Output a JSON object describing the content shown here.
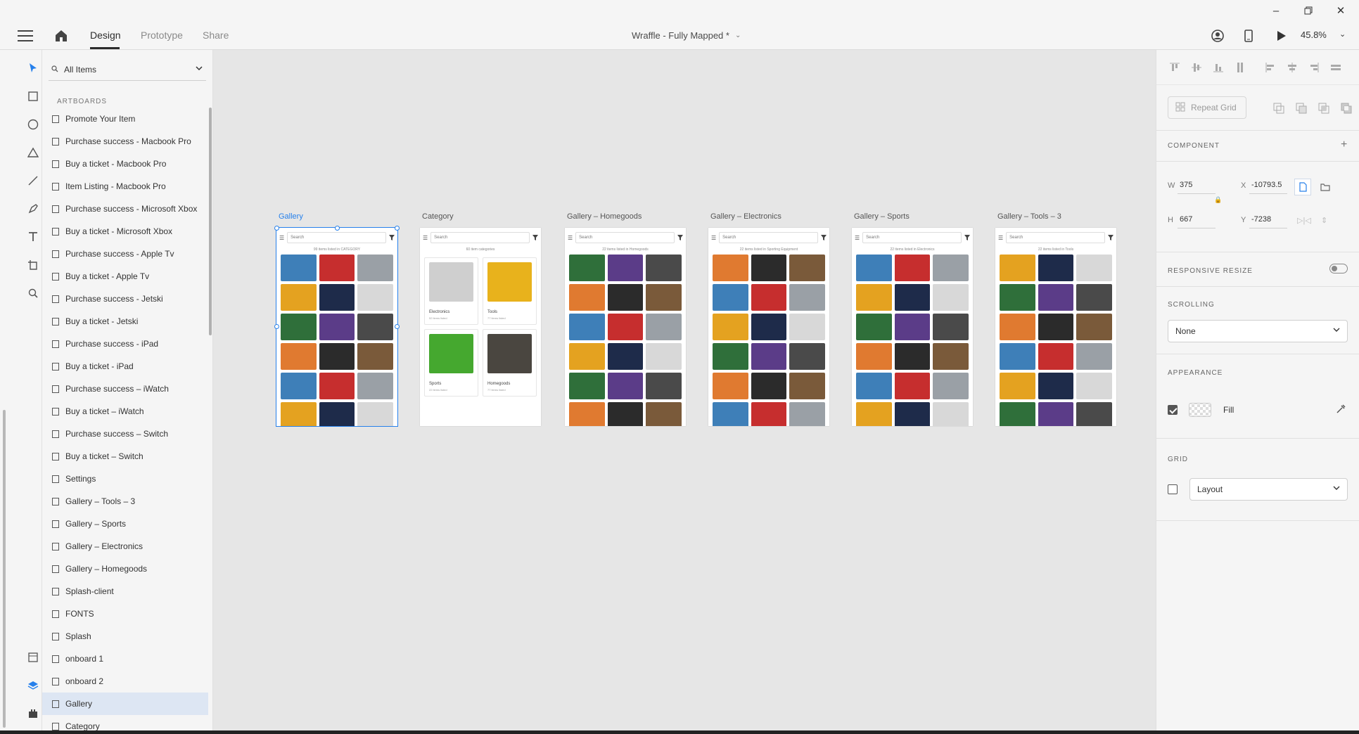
{
  "header": {
    "tabs": [
      {
        "label": "Design",
        "active": true
      },
      {
        "label": "Prototype",
        "active": false
      },
      {
        "label": "Share",
        "active": false
      }
    ],
    "document_title": "Wraffle - Fully Mapped *",
    "zoom": "45.8%"
  },
  "tools": [
    "select-tool-icon",
    "rectangle-tool-icon",
    "ellipse-tool-icon",
    "polygon-tool-icon",
    "line-tool-icon",
    "pen-tool-icon",
    "text-tool-icon",
    "artboard-tool-icon",
    "zoom-tool-icon"
  ],
  "layers": {
    "filter_label": "All Items",
    "section_label": "ARTBOARDS",
    "items": [
      "Promote  Your Item",
      "Purchase success - Macbook Pro",
      "Buy a ticket - Macbook Pro",
      "Item Listing - Macbook Pro",
      "Purchase success - Microsoft Xbox",
      "Buy a ticket - Microsoft Xbox",
      "Purchase success - Apple Tv",
      "Buy a ticket - Apple Tv",
      "Purchase success - Jetski",
      "Buy a ticket - Jetski",
      "Purchase success - iPad",
      "Buy a ticket - iPad",
      "Purchase success – iWatch",
      "Buy a ticket – iWatch",
      "Purchase success – Switch",
      "Buy a ticket – Switch",
      "Settings",
      "Gallery – Tools – 3",
      "Gallery – Sports",
      "Gallery – Electronics",
      "Gallery – Homegoods",
      "Splash-client",
      "FONTS",
      "Splash",
      "onboard 1",
      "onboard 2",
      "Gallery",
      "Category"
    ],
    "selected_index": 26
  },
  "canvas": {
    "artboards": [
      {
        "title": "Gallery",
        "search": "Search",
        "subtitle": "99 items listed in CATEGORY",
        "selected": true
      },
      {
        "title": "Category",
        "search": "Search",
        "subtitle": "60 item categories",
        "selected": false,
        "cards": [
          {
            "label": "Electronics",
            "sub": "52 items listed"
          },
          {
            "label": "Tools",
            "sub": "77 items listed"
          },
          {
            "label": "Sports",
            "sub": "22 items listed"
          },
          {
            "label": "Homegoods",
            "sub": "77 items listed"
          }
        ]
      },
      {
        "title": "Gallery – Homegoods",
        "search": "Search",
        "subtitle": "22 items listed in Homegoods",
        "selected": false
      },
      {
        "title": "Gallery – Electronics",
        "search": "Search",
        "subtitle": "22 items listed in Sporting Equipment",
        "selected": false
      },
      {
        "title": "Gallery – Sports",
        "search": "Search",
        "subtitle": "22 items listed in Electronics",
        "selected": false
      },
      {
        "title": "Gallery – Tools – 3",
        "search": "Search",
        "subtitle": "22 items listed in Tools",
        "selected": false
      }
    ]
  },
  "properties": {
    "repeat_grid_label": "Repeat Grid",
    "component_header": "COMPONENT",
    "w_label": "W",
    "w_value": "375",
    "h_label": "H",
    "h_value": "667",
    "x_label": "X",
    "x_value": "-10793.5",
    "y_label": "Y",
    "y_value": "-7238",
    "responsive_header": "RESPONSIVE RESIZE",
    "scrolling_header": "SCROLLING",
    "scrolling_value": "None",
    "appearance_header": "APPEARANCE",
    "fill_label": "Fill",
    "fill_checked": true,
    "grid_header": "GRID",
    "grid_value": "Layout",
    "grid_checked": false
  },
  "colors": {
    "accent": "#2680eb",
    "selected_row": "#dde6f3"
  }
}
